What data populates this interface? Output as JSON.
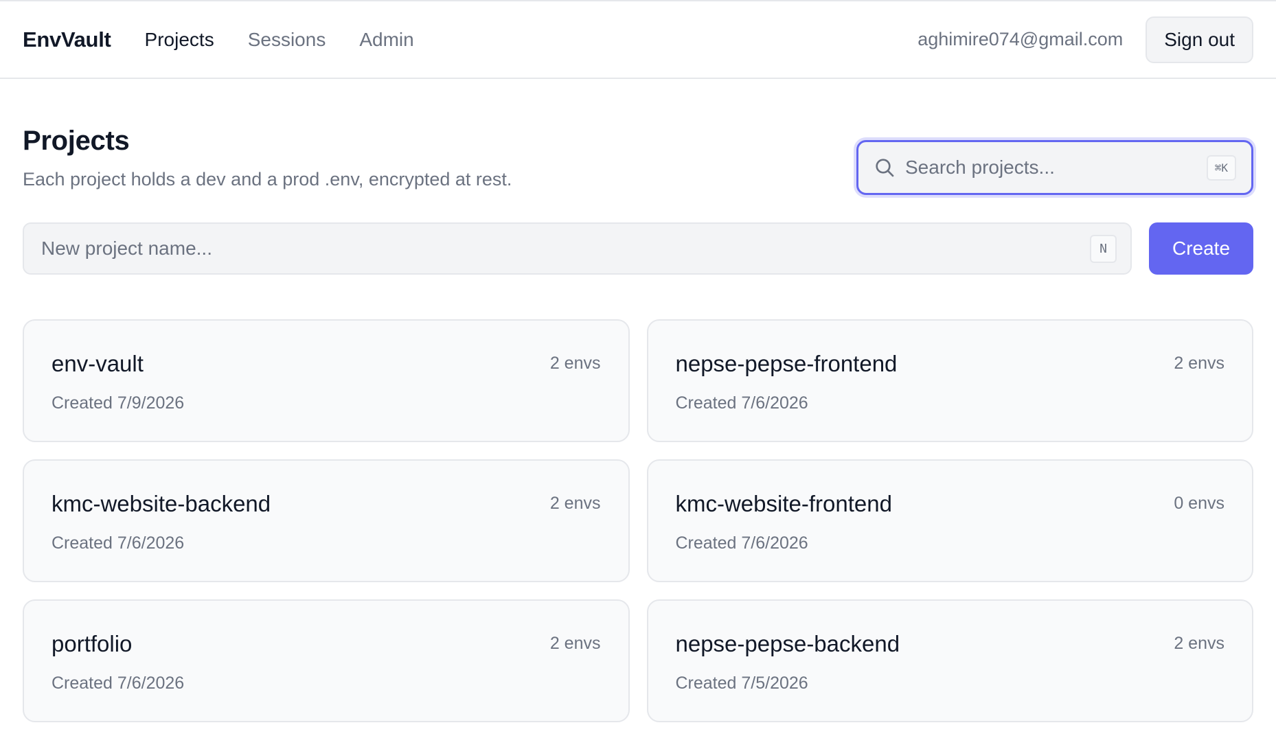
{
  "nav": {
    "brand": "EnvVault",
    "links": [
      {
        "label": "Projects",
        "active": true
      },
      {
        "label": "Sessions",
        "active": false
      },
      {
        "label": "Admin",
        "active": false
      }
    ],
    "user_email": "aghimire074@gmail.com",
    "signout_label": "Sign out"
  },
  "page": {
    "title": "Projects",
    "subtitle": "Each project holds a dev and a prod .env, encrypted at rest."
  },
  "search": {
    "placeholder": "Search projects...",
    "value": "",
    "shortcut": "⌘K",
    "icon": "search-icon"
  },
  "create": {
    "placeholder": "New project name...",
    "value": "",
    "shortcut": "N",
    "button_label": "Create"
  },
  "projects": [
    {
      "name": "env-vault",
      "envs": "2 envs",
      "created": "Created 7/9/2026"
    },
    {
      "name": "nepse-pepse-frontend",
      "envs": "2 envs",
      "created": "Created 7/6/2026"
    },
    {
      "name": "kmc-website-backend",
      "envs": "2 envs",
      "created": "Created 7/6/2026"
    },
    {
      "name": "kmc-website-frontend",
      "envs": "0 envs",
      "created": "Created 7/6/2026"
    },
    {
      "name": "portfolio",
      "envs": "2 envs",
      "created": "Created 7/6/2026"
    },
    {
      "name": "nepse-pepse-backend",
      "envs": "2 envs",
      "created": "Created 7/5/2026"
    }
  ],
  "colors": {
    "accent": "#6366f1",
    "text": "#111827",
    "muted": "#6b7280",
    "border": "#e5e7eb",
    "card_bg": "#f9fafb"
  }
}
